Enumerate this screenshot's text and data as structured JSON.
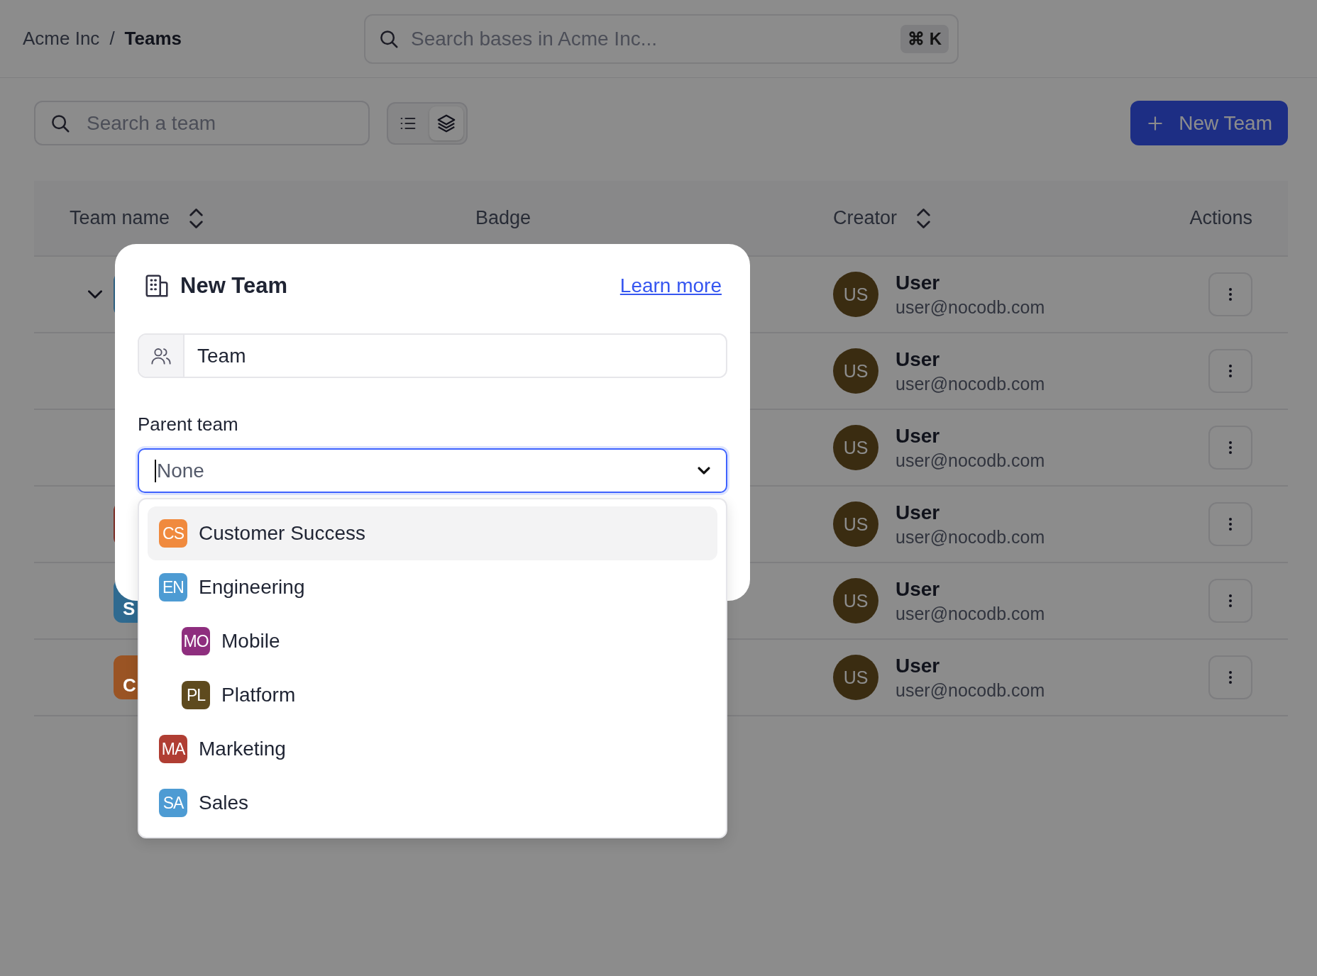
{
  "breadcrumb": {
    "items": [
      {
        "label": "Acme Inc",
        "current": false
      },
      {
        "label": "Teams",
        "current": true
      }
    ],
    "separator": "/"
  },
  "global_search": {
    "placeholder": "Search bases in Acme Inc...",
    "shortcut": "⌘ K"
  },
  "toolbar": {
    "search": {
      "placeholder": "Search a team"
    },
    "view_toggle": [
      {
        "kind": "list",
        "selected": false
      },
      {
        "kind": "tree",
        "selected": true
      }
    ],
    "new_button": {
      "label": "New Team"
    }
  },
  "table": {
    "columns": [
      {
        "label": "Team name",
        "sortable": true
      },
      {
        "label": "Badge",
        "sortable": false
      },
      {
        "label": "Creator",
        "sortable": true
      },
      {
        "label": "Actions",
        "sortable": false
      }
    ],
    "rows": [
      {
        "expanded": true,
        "badge": {
          "color": "#2c5f80"
        },
        "creator": {
          "avatar": "US",
          "name": "User",
          "email": "user@nocodb.com"
        }
      },
      {
        "creator": {
          "avatar": "US",
          "name": "User",
          "email": "user@nocodb.com"
        }
      },
      {
        "creator": {
          "avatar": "US",
          "name": "User",
          "email": "user@nocodb.com"
        }
      },
      {
        "badge": {
          "color": "#7a2a22"
        },
        "creator": {
          "avatar": "US",
          "name": "User",
          "email": "user@nocodb.com"
        }
      },
      {
        "badge": {
          "color": "#2f6a90",
          "text": "S"
        },
        "creator": {
          "avatar": "US",
          "name": "User",
          "email": "user@nocodb.com"
        }
      },
      {
        "badge": {
          "color": "#9a5424",
          "text": "C"
        },
        "creator": {
          "avatar": "US",
          "name": "User",
          "email": "user@nocodb.com"
        }
      }
    ]
  },
  "modal": {
    "title": "New Team",
    "link": "Learn more",
    "name_field": {
      "value": "Team"
    },
    "parent_label": "Parent team",
    "parent_select": {
      "value": "None",
      "focused": true
    },
    "options": [
      {
        "initials": "CS",
        "name": "Customer Success",
        "color": "#f08a3e",
        "selected": true
      },
      {
        "initials": "EN",
        "name": "Engineering",
        "color": "#4d9bd3",
        "selected": false,
        "children": [
          {
            "initials": "MO",
            "name": "Mobile",
            "color": "#8e2e7e",
            "selected": false
          },
          {
            "initials": "PL",
            "name": "Platform",
            "color": "#5e4a1e",
            "selected": false
          }
        ]
      },
      {
        "initials": "MA",
        "name": "Marketing",
        "color": "#b03e33",
        "selected": false
      },
      {
        "initials": "SA",
        "name": "Sales",
        "color": "#4d9bd3",
        "selected": false
      }
    ]
  }
}
